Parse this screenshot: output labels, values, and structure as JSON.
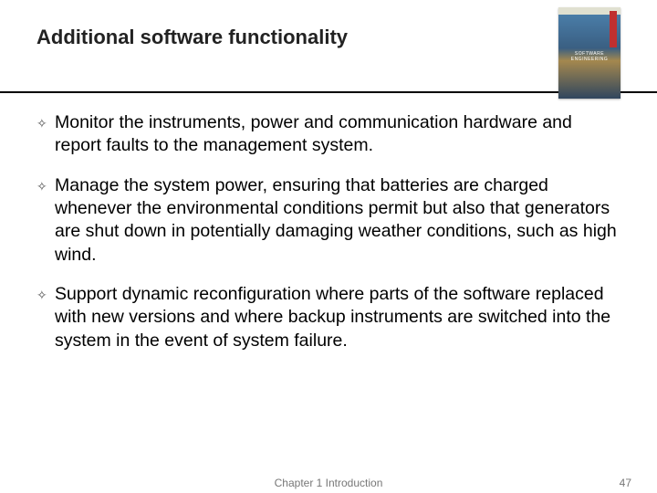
{
  "title": "Additional software functionality",
  "book_label": "SOFTWARE ENGINEERING",
  "bullets": [
    "Monitor the instruments, power and communication hardware and report faults to the management system.",
    "Manage the system power, ensuring that batteries are charged whenever the environmental conditions permit but also that generators are shut down in potentially damaging weather conditions, such as high wind.",
    "Support dynamic reconfiguration where parts of the software replaced with new versions and where backup instruments are switched into the system in the event of system failure."
  ],
  "footer_center": "Chapter 1 Introduction",
  "footer_page": "47"
}
